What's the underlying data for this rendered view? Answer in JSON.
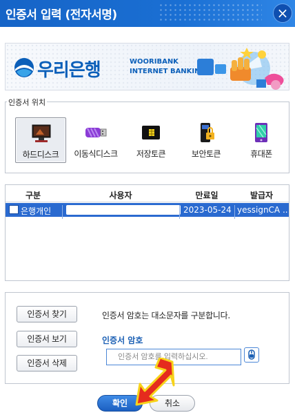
{
  "window": {
    "title": "인증서 입력 (전자서명)",
    "close_glyph": "×"
  },
  "banner": {
    "brand_name": "우리은행",
    "brand_sub_line1": "WOORIBANK",
    "brand_sub_line2": "INTERNET  BANKING"
  },
  "location": {
    "legend": "인증서 위치",
    "items": [
      {
        "label": "하드디스크",
        "icon": "monitor-icon",
        "selected": true
      },
      {
        "label": "이동식디스크",
        "icon": "usb-drive-icon",
        "selected": false
      },
      {
        "label": "저장토큰",
        "icon": "token-chip-icon",
        "selected": false
      },
      {
        "label": "보안토큰",
        "icon": "security-token-icon",
        "selected": false
      },
      {
        "label": "휴대폰",
        "icon": "mobile-phone-icon",
        "selected": false
      }
    ]
  },
  "certs": {
    "headers": [
      "구분",
      "사용자",
      "만료일",
      "발급자"
    ],
    "rows": [
      {
        "type": "은행개인",
        "user": "",
        "expiry": "2023-05-24",
        "issuer": "yessignCA ..."
      }
    ]
  },
  "actions": {
    "find_label": "인증서 찾기",
    "view_label": "인증서 보기",
    "delete_label": "인증서 삭제",
    "hint": "인증서 암호는 대소문자를 구분합니다.",
    "password_label": "인증서 암호",
    "password_placeholder": "인증서 암호를 입력하십시오."
  },
  "footer": {
    "ok_label": "확인",
    "cancel_label": "취소"
  },
  "colors": {
    "title_bar": "#1a6fd3",
    "selection": "#2a6ad0",
    "accent_text": "#1a5fb4",
    "arrow": "#e52b1e"
  }
}
